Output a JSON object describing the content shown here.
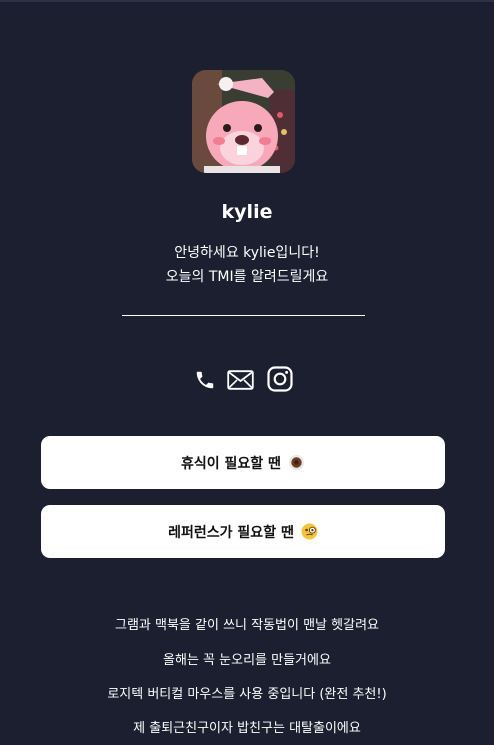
{
  "profile": {
    "name": "kylie",
    "bio_line1": "안녕하세요 kylie입니다!",
    "bio_line2": "오늘의 TMI를 알려드릴게요"
  },
  "socials": [
    {
      "icon": "phone-icon"
    },
    {
      "icon": "mail-icon"
    },
    {
      "icon": "instagram-icon"
    }
  ],
  "buttons": [
    {
      "label": "휴식이 필요할 땐",
      "emoji": "coffee-icon"
    },
    {
      "label": "레퍼런스가 필요할 땐",
      "emoji": "monocle-face-icon"
    }
  ],
  "tmi": [
    "그램과 맥북을 같이 쓰니 작동법이 맨날 헷갈려요",
    "올해는 꼭 눈오리를 만들거에요",
    "로지텍 버티컬 마우스를 사용 중입니다 (완전 추천!)",
    "제 출퇴근친구이자 밥친구는 대탈출이에요"
  ]
}
